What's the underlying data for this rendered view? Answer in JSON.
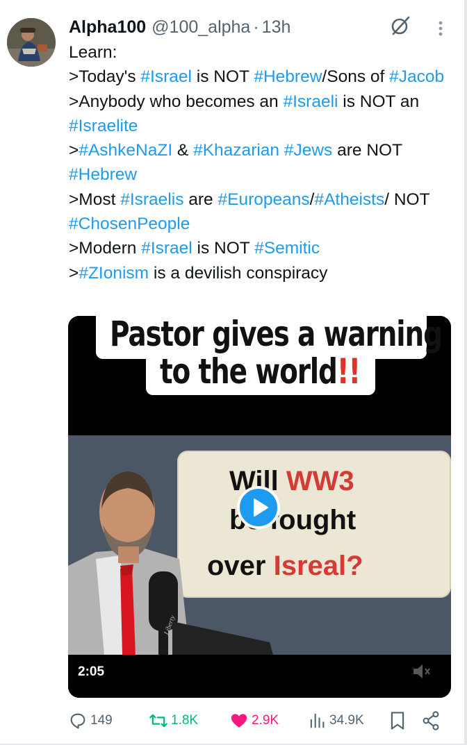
{
  "header": {
    "name": "Alpha100",
    "handle": "@100_alpha",
    "separator": "·",
    "time": "13h"
  },
  "tweet": {
    "intro": "Learn:",
    "lines": [
      [
        {
          "t": ">Today's "
        },
        {
          "t": "#Israel",
          "tag": true
        },
        {
          "t": " is NOT "
        },
        {
          "t": "#Hebrew",
          "tag": true
        },
        {
          "t": "/Sons of "
        },
        {
          "t": "#Jacob",
          "tag": true
        }
      ],
      [
        {
          "t": ">Anybody who becomes an "
        },
        {
          "t": "#Israeli",
          "tag": true
        },
        {
          "t": " is NOT an "
        },
        {
          "t": "#Israelite",
          "tag": true
        }
      ],
      [
        {
          "t": ">"
        },
        {
          "t": "#AshkeNaZI",
          "tag": true
        },
        {
          "t": " & "
        },
        {
          "t": "#Khazarian",
          "tag": true
        },
        {
          "t": " "
        },
        {
          "t": "#Jews",
          "tag": true
        },
        {
          "t": " are NOT "
        },
        {
          "t": "#Hebrew",
          "tag": true
        }
      ],
      [
        {
          "t": ">Most "
        },
        {
          "t": "#Israelis",
          "tag": true
        },
        {
          "t": " are "
        },
        {
          "t": "#Europeans",
          "tag": true
        },
        {
          "t": "/"
        },
        {
          "t": "#Atheists",
          "tag": true
        },
        {
          "t": "/ NOT "
        },
        {
          "t": "#ChosenPeople",
          "tag": true
        }
      ],
      [
        {
          "t": ">Modern "
        },
        {
          "t": "#Israel",
          "tag": true
        },
        {
          "t": " is NOT "
        },
        {
          "t": "#Semitic",
          "tag": true
        }
      ],
      [
        {
          "t": ">"
        },
        {
          "t": "#ZIonism",
          "tag": true
        },
        {
          "t": " is a devilish conspiracy"
        }
      ]
    ]
  },
  "video": {
    "caption_line1": "Pastor gives a warning",
    "caption_line2": "to the world",
    "caption_bangs": "!!",
    "sign_will": "Will",
    "sign_ww3": "WW3",
    "sign_be": "be",
    "sign_fought": "fought",
    "sign_over": "over",
    "sign_isreal": "Isreal?",
    "mic_brand": "Liberty",
    "duration": "2:05"
  },
  "actions": {
    "replies": "149",
    "reposts": "1.8K",
    "likes": "2.9K",
    "views": "34.9K"
  },
  "colors": {
    "hashtag": "#1d9bf0",
    "like": "#f91880",
    "repost": "#00ba7c",
    "muted": "#536471"
  }
}
